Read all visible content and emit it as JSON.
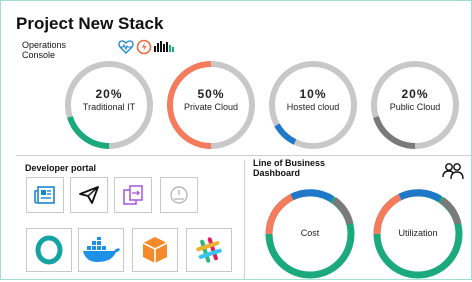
{
  "app": {
    "title": "Project New Stack"
  },
  "operations": {
    "label_line1": "Operations",
    "label_line2": "Console",
    "icons": [
      "heartbeat-icon",
      "power-icon",
      "signal-icon"
    ],
    "gauges": [
      {
        "percent": "20%",
        "label": "Traditional IT",
        "color": "#1aaa7b"
      },
      {
        "percent": "50%",
        "label": "Private Cloud",
        "color": "#f47c5c"
      },
      {
        "percent": "10%",
        "label": "Hosted cloud",
        "color": "#1f78c8"
      },
      {
        "percent": "20%",
        "label": "Public Cloud",
        "color": "#7a7a7a"
      }
    ]
  },
  "developer_portal": {
    "title": "Developer portal",
    "tools": [
      "news-icon",
      "send-icon",
      "transfer-icon",
      "speedometer-icon"
    ],
    "apps": [
      "openshift-icon",
      "docker-icon",
      "package-icon",
      "slack-icon"
    ]
  },
  "lob": {
    "title_line1": "Line of Business",
    "title_line2": "Dashboard",
    "people_icon": "people-icon",
    "donuts": [
      {
        "label": "Cost"
      },
      {
        "label": "Utilization"
      }
    ],
    "colors": {
      "orange": "#f47c5c",
      "blue": "#1f78c8",
      "grey": "#7a7a7a",
      "green": "#1aaa7b"
    }
  }
}
